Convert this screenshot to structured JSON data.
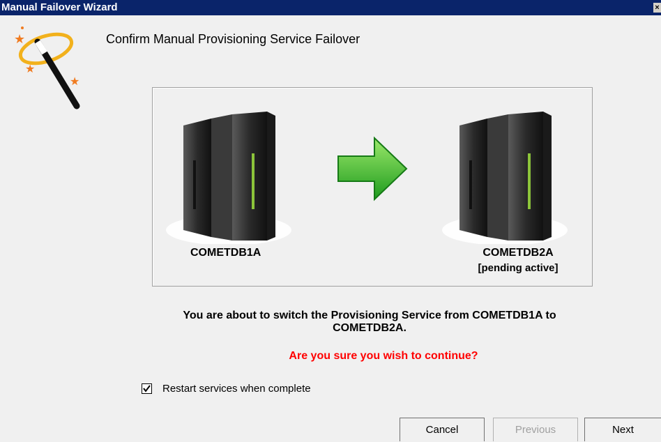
{
  "window": {
    "title": "Manual Failover Wizard",
    "close_glyph": "×"
  },
  "page": {
    "heading": "Confirm Manual Provisioning Service Failover"
  },
  "diagram": {
    "source_server": "COMETDB1A",
    "target_server": "COMETDB2A",
    "target_status": "[pending active]",
    "arrow_color": "#3fbf2a"
  },
  "message": {
    "line1": "You are about to switch the Provisioning Service from COMETDB1A to",
    "line2": "COMETDB2A.",
    "confirm": "Are you sure you wish to continue?",
    "confirm_color": "#ff0000"
  },
  "options": {
    "restart_label": "Restart services when complete",
    "restart_checked": true
  },
  "buttons": {
    "cancel": "Cancel",
    "previous": "Previous",
    "next": "Next"
  },
  "icons": {
    "wizard": "magic-wand-icon",
    "server": "server-tower-icon",
    "arrow": "arrow-right-icon",
    "check": "checkmark-icon"
  }
}
